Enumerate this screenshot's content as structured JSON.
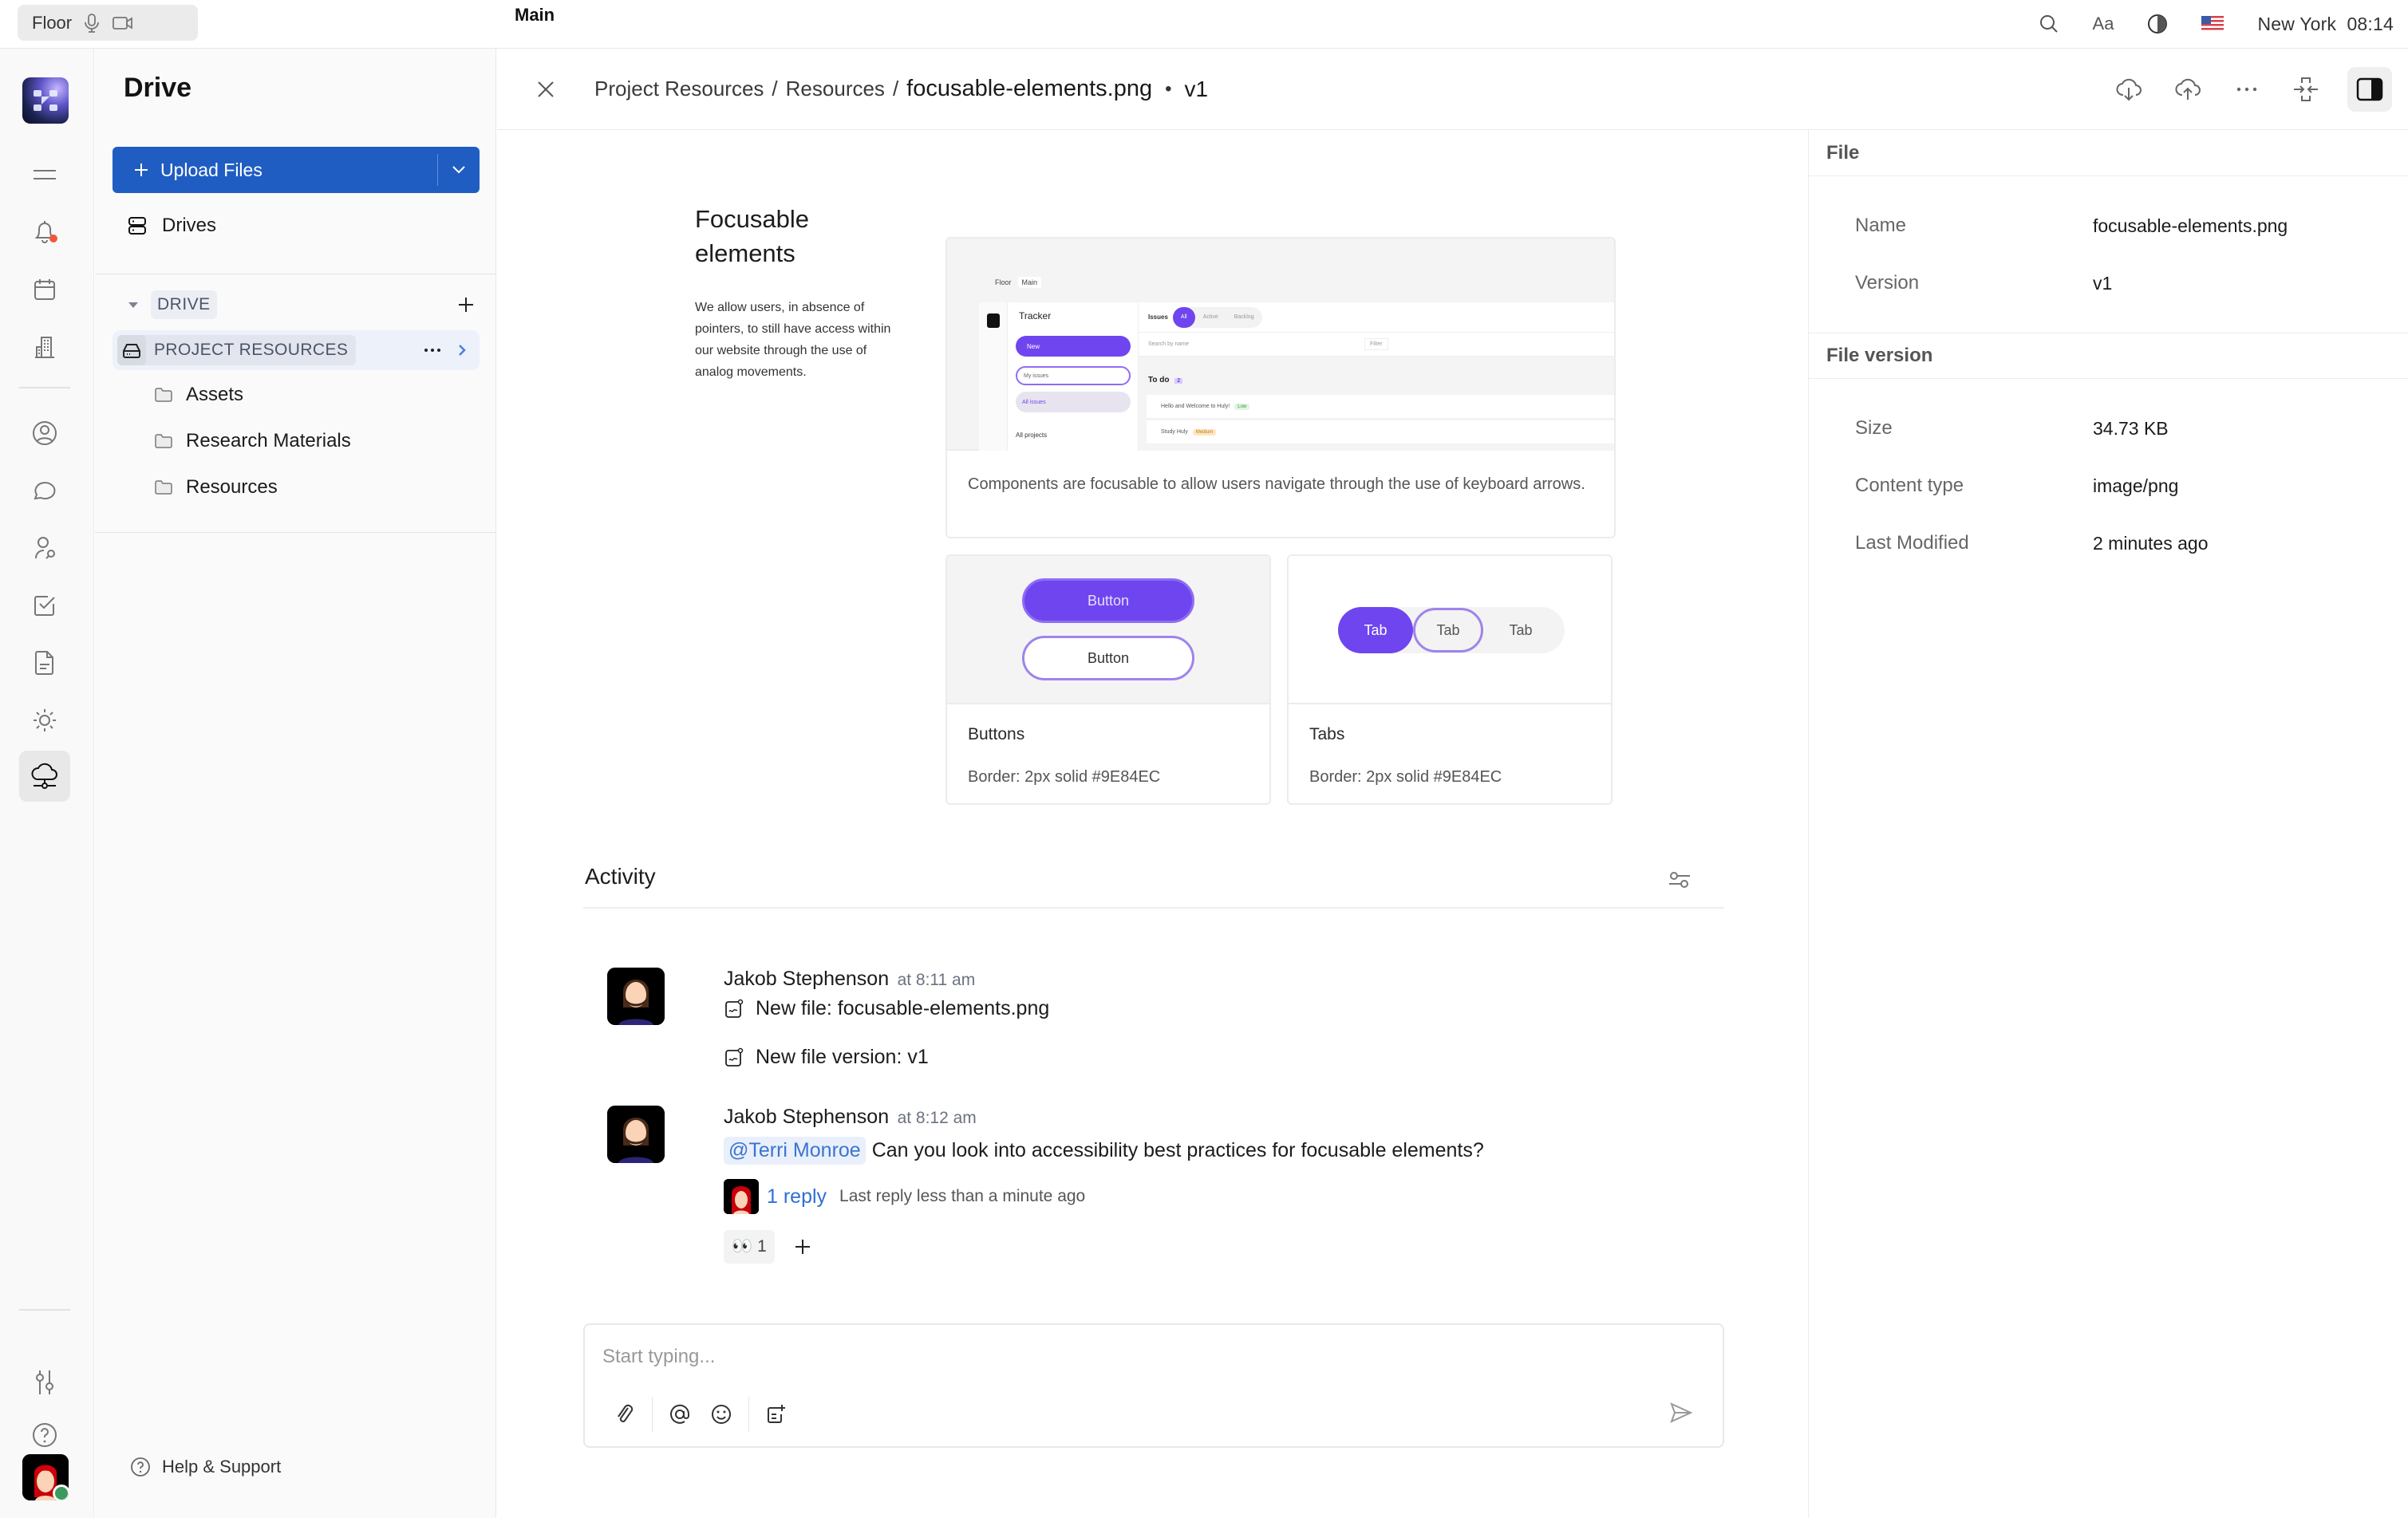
{
  "topbar": {
    "workspace": "Floor",
    "room": "Main",
    "font_size_label": "Aa",
    "location": "New York",
    "time": "08:14"
  },
  "rail": {
    "items": [
      {
        "name": "menu",
        "icon": "hamburger-icon"
      },
      {
        "name": "notifications",
        "icon": "bell-icon",
        "has_badge": true
      },
      {
        "name": "calendar",
        "icon": "calendar-icon"
      },
      {
        "name": "office",
        "icon": "building-icon"
      },
      {
        "name": "contacts",
        "icon": "person-circle-icon"
      },
      {
        "name": "chat",
        "icon": "chat-bubble-icon"
      },
      {
        "name": "recruiting",
        "icon": "person-search-icon"
      },
      {
        "name": "tracker",
        "icon": "checkbox-icon"
      },
      {
        "name": "documents",
        "icon": "document-icon"
      },
      {
        "name": "tasks",
        "icon": "sun-icon"
      },
      {
        "name": "drive",
        "icon": "cloud-network-icon",
        "active": true
      }
    ],
    "bottom": [
      {
        "name": "settings",
        "icon": "sliders-icon"
      },
      {
        "name": "help",
        "icon": "question-circle-icon"
      }
    ],
    "badge_color": "#F0583C",
    "online_color": "#3B9A5E"
  },
  "nav": {
    "title": "Drive",
    "upload_label": "Upload Files",
    "drives_label": "Drives",
    "section_label": "DRIVE",
    "space_label": "PROJECT RESOURCES",
    "folders": [
      "Assets",
      "Research Materials",
      "Resources"
    ],
    "help_label": "Help & Support",
    "accent_color": "#205DC2"
  },
  "header": {
    "breadcrumb": [
      "Project Resources",
      "Resources"
    ],
    "separator": "/",
    "file_name": "focusable-elements.png",
    "bullet": "•",
    "version": "v1"
  },
  "preview": {
    "title_line1": "Focusable",
    "title_line2": "elements",
    "description": "We allow users, in absence of pointers, to still have access within our website through the use of analog movements.",
    "main_caption": "Components are focusable to allow users navigate through the use of keyboard arrows.",
    "mini": {
      "top": [
        "Floor",
        "Main"
      ],
      "app_title": "Tracker",
      "new_label": "New",
      "my_issues": "My issues",
      "all_issues": "All issues",
      "all_projects": "All projects",
      "issues_label": "Issues",
      "tabs": [
        "All",
        "Active",
        "Backlog"
      ],
      "search_placeholder": "Search by name",
      "filter_label": "Filter",
      "group": "To do",
      "group_count": "2",
      "rows": [
        {
          "title": "Hello and Welcome to Huly!",
          "tag": "Low"
        },
        {
          "title": "Study Huly",
          "tag": "Medium"
        }
      ]
    },
    "buttons_card": {
      "button_label": "Button",
      "title": "Buttons",
      "subtitle": "Border: 2px solid #9E84EC"
    },
    "tabs_card": {
      "tabs": [
        "Tab",
        "Tab",
        "Tab"
      ],
      "title": "Tabs",
      "subtitle": "Border: 2px solid #9E84EC"
    },
    "accent_color": "#6F45EF",
    "focus_color": "#9E84EC"
  },
  "activity": {
    "title": "Activity",
    "messages": [
      {
        "author": "Jakob Stephenson",
        "time": "at 8:11 am",
        "events": [
          "New file: focusable-elements.png",
          "New file version: v1"
        ]
      },
      {
        "author": "Jakob Stephenson",
        "time": "at 8:12 am",
        "mention": "@Terri Monroe",
        "text": "Can you look into accessibility best practices for focusable elements?",
        "reply_count": "1 reply",
        "last_reply": "Last reply less than a minute ago",
        "reaction_emoji": "👀",
        "reaction_count": "1"
      }
    ]
  },
  "composer": {
    "placeholder": "Start typing...",
    "value": ""
  },
  "details": {
    "file_section": "File",
    "file_rows": [
      {
        "key": "Name",
        "value": "focusable-elements.png"
      },
      {
        "key": "Version",
        "value": "v1"
      }
    ],
    "version_section": "File version",
    "version_rows": [
      {
        "key": "Size",
        "value": "34.73 KB"
      },
      {
        "key": "Content type",
        "value": "image/png"
      },
      {
        "key": "Last Modified",
        "value": "2 minutes ago"
      }
    ]
  }
}
